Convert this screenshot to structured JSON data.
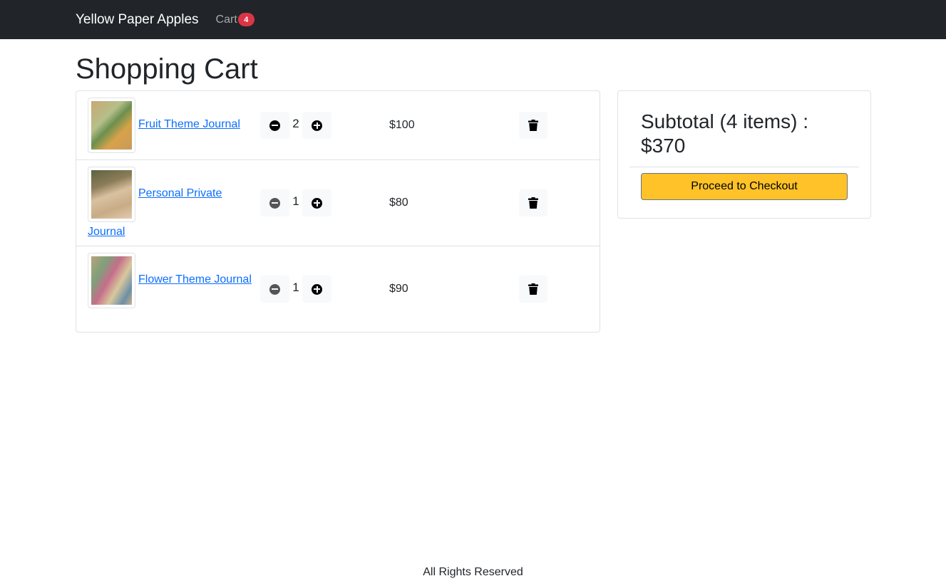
{
  "navbar": {
    "brand": "Yellow Paper Apples",
    "cart_label": "Cart",
    "cart_count": "4"
  },
  "page": {
    "title": "Shopping Cart"
  },
  "cart": {
    "items": [
      {
        "name": "Fruit Theme Journal",
        "quantity": "2",
        "price": "$100",
        "image": "journal-thumbnail-fruit"
      },
      {
        "name": "Personal Private Journal",
        "quantity": "1",
        "price": "$80",
        "image": "journal-thumbnail-personal"
      },
      {
        "name": "Flower Theme Journal",
        "quantity": "1",
        "price": "$90",
        "image": "journal-thumbnail-flower"
      }
    ]
  },
  "summary": {
    "subtotal_text": "Subtotal (4 items) : $370",
    "checkout_label": "Proceed to Checkout"
  },
  "footer": {
    "text": "All Rights Reserved"
  },
  "icons": {
    "decrease": "minus-circle-icon",
    "increase": "plus-circle-icon",
    "delete": "trash-icon"
  },
  "colors": {
    "navbar_bg": "#212529",
    "badge": "#dc3545",
    "link": "#0d6efd",
    "checkout_bg": "#ffc229"
  }
}
